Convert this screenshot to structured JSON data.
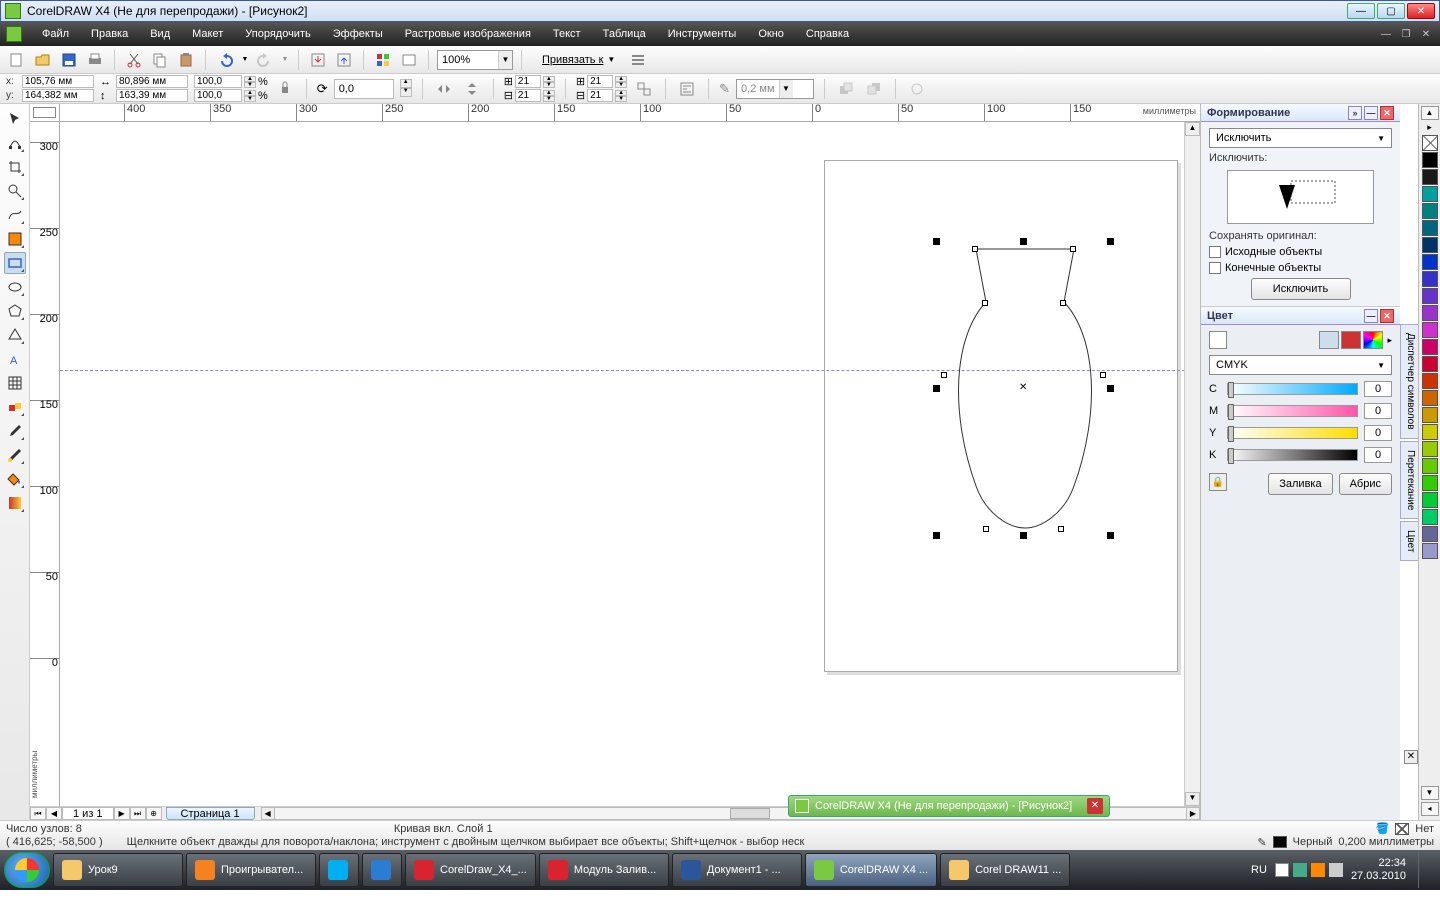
{
  "titlebar": {
    "text": "CorelDRAW X4 (Не для перепродажи) - [Рисунок2]"
  },
  "menubar": {
    "items": [
      "Файл",
      "Правка",
      "Вид",
      "Макет",
      "Упорядочить",
      "Эффекты",
      "Растровые изображения",
      "Текст",
      "Таблица",
      "Инструменты",
      "Окно",
      "Справка"
    ]
  },
  "toolbar1": {
    "zoom": "100%",
    "snap_label": "Привязать к"
  },
  "propbar": {
    "x_label": "x:",
    "x_val": "105,76 мм",
    "y_label": "y:",
    "y_val": "164,382 мм",
    "w_val": "80,896 мм",
    "h_val": "163,39 мм",
    "scale_x": "100,0",
    "scale_y": "100,0",
    "pct": "%",
    "rot": "0,0",
    "colrow_a": "21",
    "colrow_b": "21",
    "outline": "0,2 мм"
  },
  "rulers": {
    "h_units": "миллиметры",
    "v_units": "миллиметры",
    "h_ticks": [
      {
        "pos": 64,
        "label": "400"
      },
      {
        "pos": 150,
        "label": "350"
      },
      {
        "pos": 236,
        "label": "300"
      },
      {
        "pos": 322,
        "label": "250"
      },
      {
        "pos": 408,
        "label": "200"
      },
      {
        "pos": 494,
        "label": "150"
      },
      {
        "pos": 580,
        "label": "100"
      },
      {
        "pos": 666,
        "label": "50"
      },
      {
        "pos": 752,
        "label": "0"
      },
      {
        "pos": 838,
        "label": "50"
      },
      {
        "pos": 924,
        "label": "100"
      },
      {
        "pos": 1010,
        "label": "150"
      }
    ],
    "v_ticks": [
      {
        "pos": 20,
        "label": "300"
      },
      {
        "pos": 106,
        "label": "250"
      },
      {
        "pos": 192,
        "label": "200"
      },
      {
        "pos": 278,
        "label": "150"
      },
      {
        "pos": 364,
        "label": "100"
      },
      {
        "pos": 450,
        "label": "50"
      },
      {
        "pos": 536,
        "label": "0"
      }
    ]
  },
  "page_nav": {
    "counter": "1 из 1",
    "tab": "Страница 1"
  },
  "docker_shaping": {
    "title": "Формирование",
    "mode": "Исключить",
    "section_label": "Исключить:",
    "keep_label": "Сохранять оригинал:",
    "chk_source": "Исходные объекты",
    "chk_target": "Конечные объекты",
    "apply": "Исключить"
  },
  "docker_color": {
    "title": "Цвет",
    "model": "CMYK",
    "channels": {
      "C": "0",
      "M": "0",
      "Y": "0",
      "K": "0"
    },
    "btn_fill": "Заливка",
    "btn_outline": "Абрис"
  },
  "side_tabs": [
    "Диспетчер символов",
    "Перетекание",
    "Цвет"
  ],
  "palette": {
    "colors": [
      "#000000",
      "#1a1a1a",
      "#00a0a0",
      "#008080",
      "#006680",
      "#003366",
      "#0033cc",
      "#3333cc",
      "#6633cc",
      "#9933cc",
      "#cc33cc",
      "#cc0066",
      "#cc0033",
      "#cc3300",
      "#cc6600",
      "#cc9900",
      "#cccc00",
      "#99cc00",
      "#66cc00",
      "#33cc00",
      "#00cc33",
      "#00cc66",
      "#666699",
      "#9999cc"
    ]
  },
  "status": {
    "nodes_label": "Число узлов: 8",
    "object_label": "Кривая вкл. Слой 1",
    "coords": "( 416,625; -58,500 )",
    "hint": "Щелкните объект дважды для поворота/наклона; инструмент с двойным щелчком выбирает все объекты; Shift+щелчок - выбор неск",
    "fill_label": "Нет",
    "outline_color": "Черный",
    "outline_width": "0,200 миллиметры"
  },
  "flash": {
    "text": "CorelDRAW X4 (Не для перепродажи) - [Рисунок2]"
  },
  "taskbar": {
    "items": [
      {
        "label": "Урок9",
        "color": "#f5c96b"
      },
      {
        "label": "Проигрывател...",
        "color": "#f58220"
      },
      {
        "label": "",
        "color": "#00aff0"
      },
      {
        "label": "",
        "color": "#2b7cd3"
      },
      {
        "label": "CorelDraw_X4_...",
        "color": "#d9232e"
      },
      {
        "label": "Модуль Залив...",
        "color": "#d9232e"
      },
      {
        "label": "Документ1 - ...",
        "color": "#2b579a"
      },
      {
        "label": "CorelDRAW X4 ...",
        "color": "#7ac943",
        "active": true
      },
      {
        "label": "Corel DRAW11 ...",
        "color": "#f5c96b"
      }
    ],
    "lang": "RU",
    "time": "22:34",
    "date": "27.03.2010"
  }
}
